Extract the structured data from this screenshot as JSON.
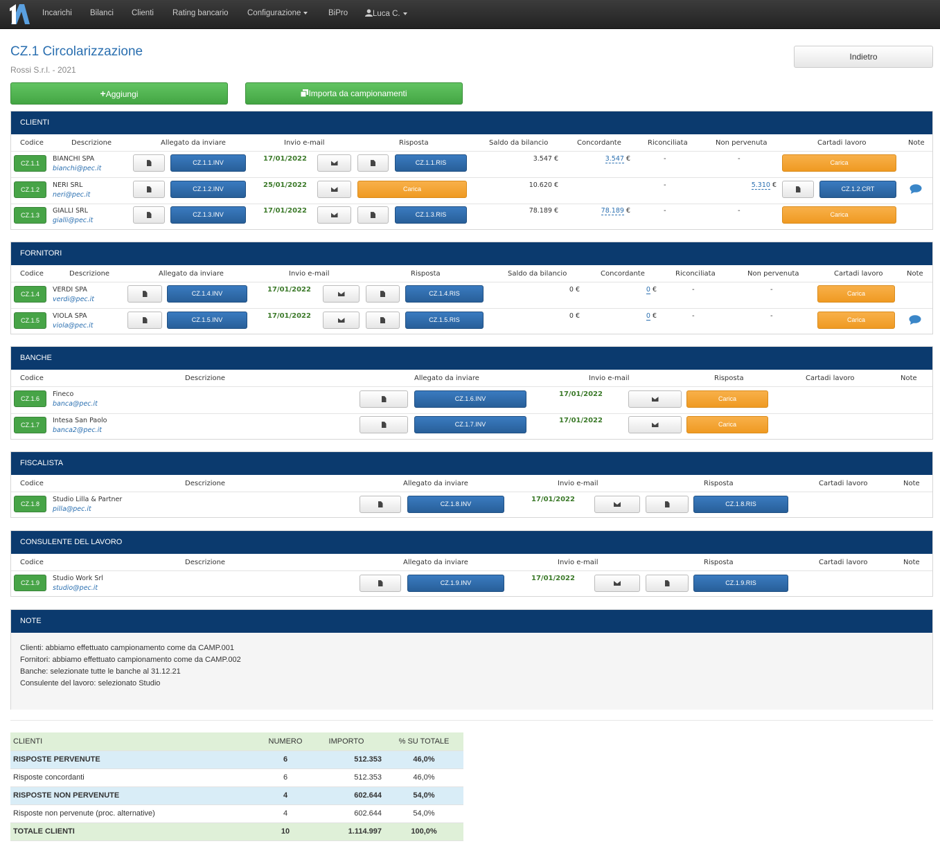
{
  "nav": {
    "logo_text": "1A",
    "items": [
      "Incarichi",
      "Bilanci",
      "Clienti",
      "Rating bancario",
      "Configurazione",
      "BiPro"
    ],
    "user": "Luca C."
  },
  "header": {
    "title": "CZ.1 Circolarizzazione",
    "subtitle": "Rossi S.r.l. - 2021",
    "back_label": "Indietro",
    "add_label": "Aggiungi",
    "import_label": "Importa da campionamenti"
  },
  "labels": {
    "carica": "Carica",
    "dash": "-"
  },
  "clienti": {
    "title": "CLIENTI",
    "headers": [
      "Codice",
      "Descrizione",
      "Allegato da inviare",
      "Invio e-mail",
      "Risposta",
      "Saldo da bilancio",
      "Concordante",
      "Riconciliata",
      "Non pervenuta",
      "Cartadi lavoro",
      "Note"
    ],
    "rows": [
      {
        "code": "CZ.1.1",
        "name": "BIANCHI SPA",
        "email": "bianchi@pec.it",
        "inv": "CZ.1.1.INV",
        "date": "17/01/2022",
        "ris": "CZ.1.1.RIS",
        "saldo": "3.547 €",
        "conc": "3.547",
        "conc_suffix": " €",
        "ric": "-",
        "nonperv": "-"
      },
      {
        "code": "CZ.1.2",
        "name": "NERI SRL",
        "email": "neri@pec.it",
        "inv": "CZ.1.2.INV",
        "date": "25/01/2022",
        "saldo": "10.620 €",
        "ric": "-",
        "nonperv": "5.310",
        "nonperv_suffix": " €",
        "crt": "CZ.1.2.CRT"
      },
      {
        "code": "CZ.1.3",
        "name": "GIALLI SRL",
        "email": "gialli@pec.it",
        "inv": "CZ.1.3.INV",
        "date": "17/01/2022",
        "ris": "CZ.1.3.RIS",
        "saldo": "78.189 €",
        "conc": "78.189",
        "conc_suffix": " €",
        "ric": "-",
        "nonperv": "-"
      }
    ]
  },
  "fornitori": {
    "title": "FORNITORI",
    "headers": [
      "Codice",
      "Descrizione",
      "Allegato da inviare",
      "Invio e-mail",
      "Risposta",
      "Saldo da bilancio",
      "Concordante",
      "Riconciliata",
      "Non pervenuta",
      "Cartadi lavoro",
      "Note"
    ],
    "rows": [
      {
        "code": "CZ.1.4",
        "name": "VERDI SPA",
        "email": "verdi@pec.it",
        "inv": "CZ.1.4.INV",
        "date": "17/01/2022",
        "ris": "CZ.1.4.RIS",
        "saldo": "0 €",
        "conc": "0",
        "conc_suffix": " €",
        "ric": "-",
        "nonperv": "-"
      },
      {
        "code": "CZ.1.5",
        "name": "VIOLA SPA",
        "email": "viola@pec.it",
        "inv": "CZ.1.5.INV",
        "date": "17/01/2022",
        "ris": "CZ.1.5.RIS",
        "saldo": "0 €",
        "conc": "0",
        "conc_suffix": " €",
        "ric": "-",
        "nonperv": "-"
      }
    ]
  },
  "banche": {
    "title": "BANCHE",
    "headers": [
      "Codice",
      "Descrizione",
      "Allegato da inviare",
      "Invio e-mail",
      "Risposta",
      "Cartadi lavoro",
      "Note"
    ],
    "rows": [
      {
        "code": "CZ.1.6",
        "name": "Fineco",
        "email": "banca@pec.it",
        "inv": "CZ.1.6.INV",
        "date": "17/01/2022"
      },
      {
        "code": "CZ.1.7",
        "name": "Intesa San Paolo",
        "email": "banca2@pec.it",
        "inv": "CZ.1.7.INV",
        "date": "17/01/2022"
      }
    ]
  },
  "fiscalista": {
    "title": "FISCALISTA",
    "headers": [
      "Codice",
      "Descrizione",
      "Allegato da inviare",
      "Invio e-mail",
      "Risposta",
      "Cartadi lavoro",
      "Note"
    ],
    "rows": [
      {
        "code": "CZ.1.8",
        "name": "Studio Lilla & Partner",
        "email": "pilla@pec.it",
        "inv": "CZ.1.8.INV",
        "date": "17/01/2022",
        "ris": "CZ.1.8.RIS"
      }
    ]
  },
  "consulente": {
    "title": "CONSULENTE DEL LAVORO",
    "headers": [
      "Codice",
      "Descrizione",
      "Allegato da inviare",
      "Invio e-mail",
      "Risposta",
      "Cartadi lavoro",
      "Note"
    ],
    "rows": [
      {
        "code": "CZ.1.9",
        "name": "Studio Work Srl",
        "email": "studio@pec.it",
        "inv": "CZ.1.9.INV",
        "date": "17/01/2022",
        "ris": "CZ.1.9.RIS"
      }
    ]
  },
  "note": {
    "title": "NOTE",
    "lines": [
      "Clienti: abbiamo effettuato campionamento come da CAMP.001",
      "Fornitori: abbiamo effettuato campionamento come da CAMP.002",
      "Banche: selezionate tutte le banche al 31.12.21",
      "Consulente del lavoro: selezionato Studio"
    ]
  },
  "summary": {
    "headers": [
      "CLIENTI",
      "NUMERO",
      "IMPORTO",
      "% SU TOTALE"
    ],
    "rows": [
      {
        "label": "RISPOSTE PERVENUTE",
        "numero": "6",
        "importo": "512.353",
        "perc": "46,0%"
      },
      {
        "label": "Risposte concordanti",
        "numero": "6",
        "importo": "512.353",
        "perc": "46,0%"
      },
      {
        "label": "RISPOSTE NON PERVENUTE",
        "numero": "4",
        "importo": "602.644",
        "perc": "54,0%"
      },
      {
        "label": "Risposte non pervenute (proc. alternative)",
        "numero": "4",
        "importo": "602.644",
        "perc": "54,0%"
      },
      {
        "label": "TOTALE CLIENTI",
        "numero": "10",
        "importo": "1.114.997",
        "perc": "100,0%"
      }
    ]
  }
}
